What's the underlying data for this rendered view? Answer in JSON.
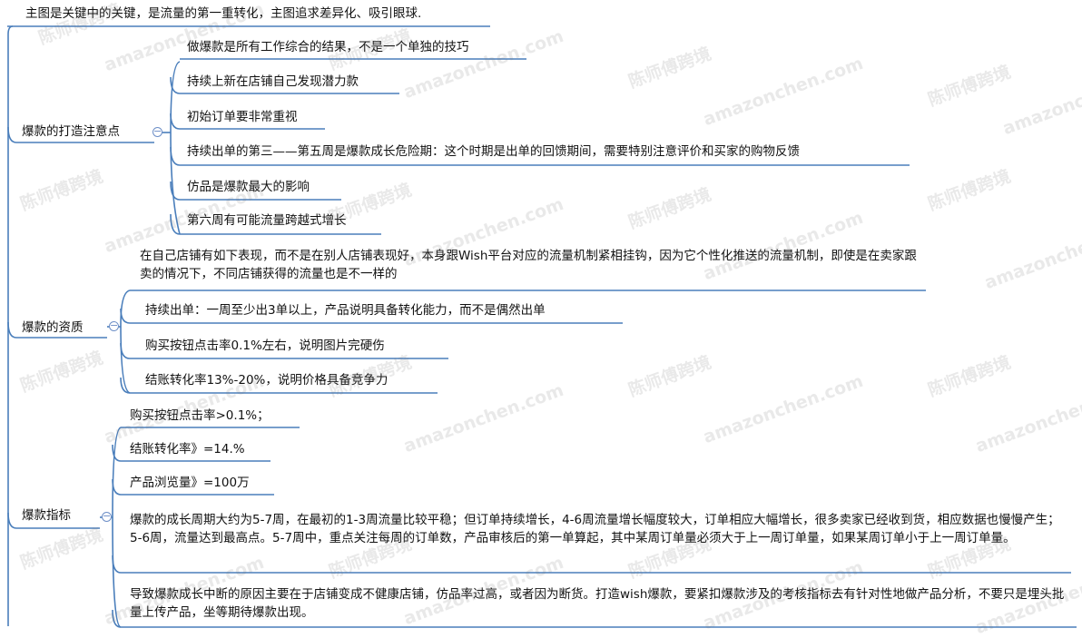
{
  "colors": {
    "line": "#4a7ebb",
    "underline": "#4a7ebb",
    "text": "#111111",
    "collapse": "#6d8fc7"
  },
  "root": {
    "text": "主图是关键中的关键，是流量的第一重转化，主图追求差异化、吸引眼球."
  },
  "branches": [
    {
      "label": "爆款的打造注意点",
      "items": [
        "做爆款是所有工作综合的结果，不是一个单独的技巧",
        "持续上新在店铺自己发现潜力款",
        "初始订单要非常重视",
        "持续出单的第三——第五周是爆款成长危险期：这个时期是出单的回馈期间，需要特别注意评价和买家的购物反馈",
        "仿品是爆款最大的影响",
        "第六周有可能流量跨越式增长"
      ]
    },
    {
      "label": "爆款的资质",
      "items": [
        "在自己店铺有如下表现，而不是在别人店铺表现好，本身跟Wish平台对应的流量机制紧相挂钩，因为它个性化推送的流量机制，即使是在卖家跟卖的情况下，不同店铺获得的流量也是不一样的",
        "持续出单：一周至少出3单以上，产品说明具备转化能力，而不是偶然出单",
        "购买按钮点击率0.1%左右，说明图片完硬伤",
        "结账转化率13%-20%，说明价格具备竞争力"
      ]
    },
    {
      "label": "爆款指标",
      "items": [
        "购买按钮点击率>0.1%；",
        "结账转化率》=14.%",
        "产品浏览量》=100万",
        "爆款的成长周期大约为5-7周，在最初的1-3周流量比较平稳；但订单持续增长，4-6周流量增长幅度较大，订单相应大幅增长，很多卖家已经收到货，相应数据也慢慢产生；5-6周，流量达到最高点。5-7周中，重点关注每周的订单数，产品审核后的第一单算起，其中某周订单量必须大于上一周订单量，如果某周订单小于上一周订单量。",
        "导致爆款成长中断的原因主要在于店铺变成不健康店铺，仿品率过高，或者因为断货。打造wish爆款，要紧扣爆款涉及的考核指标去有针对性地做产品分析，不要只是埋头批量上传产品，坐等期待爆款出现。"
      ]
    }
  ],
  "watermarks": [
    "陈师傅跨境",
    "amazonchen.com"
  ]
}
